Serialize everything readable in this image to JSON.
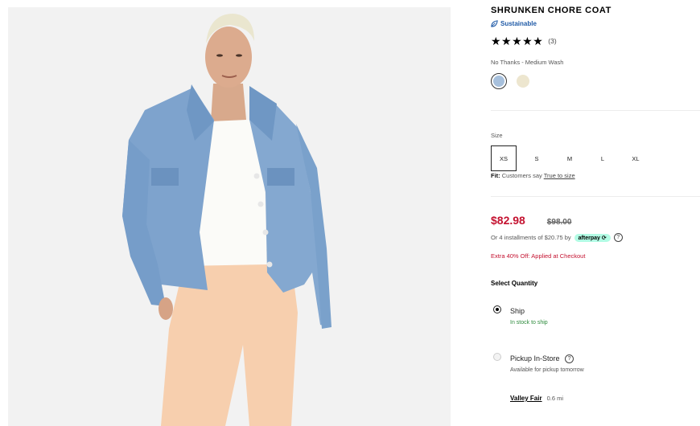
{
  "product": {
    "title": "SHRUNKEN CHORE COAT",
    "sustainable_label": "Sustainable",
    "stars": "★★★★★",
    "review_count": "(3)",
    "rating": 5,
    "color_name": "No Thanks - Medium Wash",
    "swatches": [
      {
        "name": "medium-wash",
        "color": "#a7c0dc",
        "selected": true
      },
      {
        "name": "ecru",
        "color": "#ede6cf",
        "selected": false
      }
    ]
  },
  "size": {
    "label": "Size",
    "options": [
      "XS",
      "S",
      "M",
      "L",
      "XL"
    ],
    "selected": "XS",
    "fit_label": "Fit:",
    "fit_text": "Customers say",
    "fit_link": "True to size"
  },
  "pricing": {
    "sale_price": "$82.98",
    "original_price": "$98.00",
    "installments_text": "Or 4 installments of $20.75 by",
    "afterpay_label": "afterpay",
    "help_glyph": "?",
    "promo": "Extra 40% Off: Applied at Checkout"
  },
  "quantity": {
    "title": "Select Quantity",
    "ship_label": "Ship",
    "ship_status": "In stock to ship",
    "pickup_label": "Pickup In-Store",
    "pickup_status": "Available for pickup tomorrow",
    "store_name": "Valley Fair",
    "store_distance": "0.6 mi"
  },
  "colors": {
    "sale": "#c41230",
    "in_stock": "#2e8b3d",
    "sustainable": "#1f5aa6",
    "afterpay_bg": "#b2fce4"
  }
}
